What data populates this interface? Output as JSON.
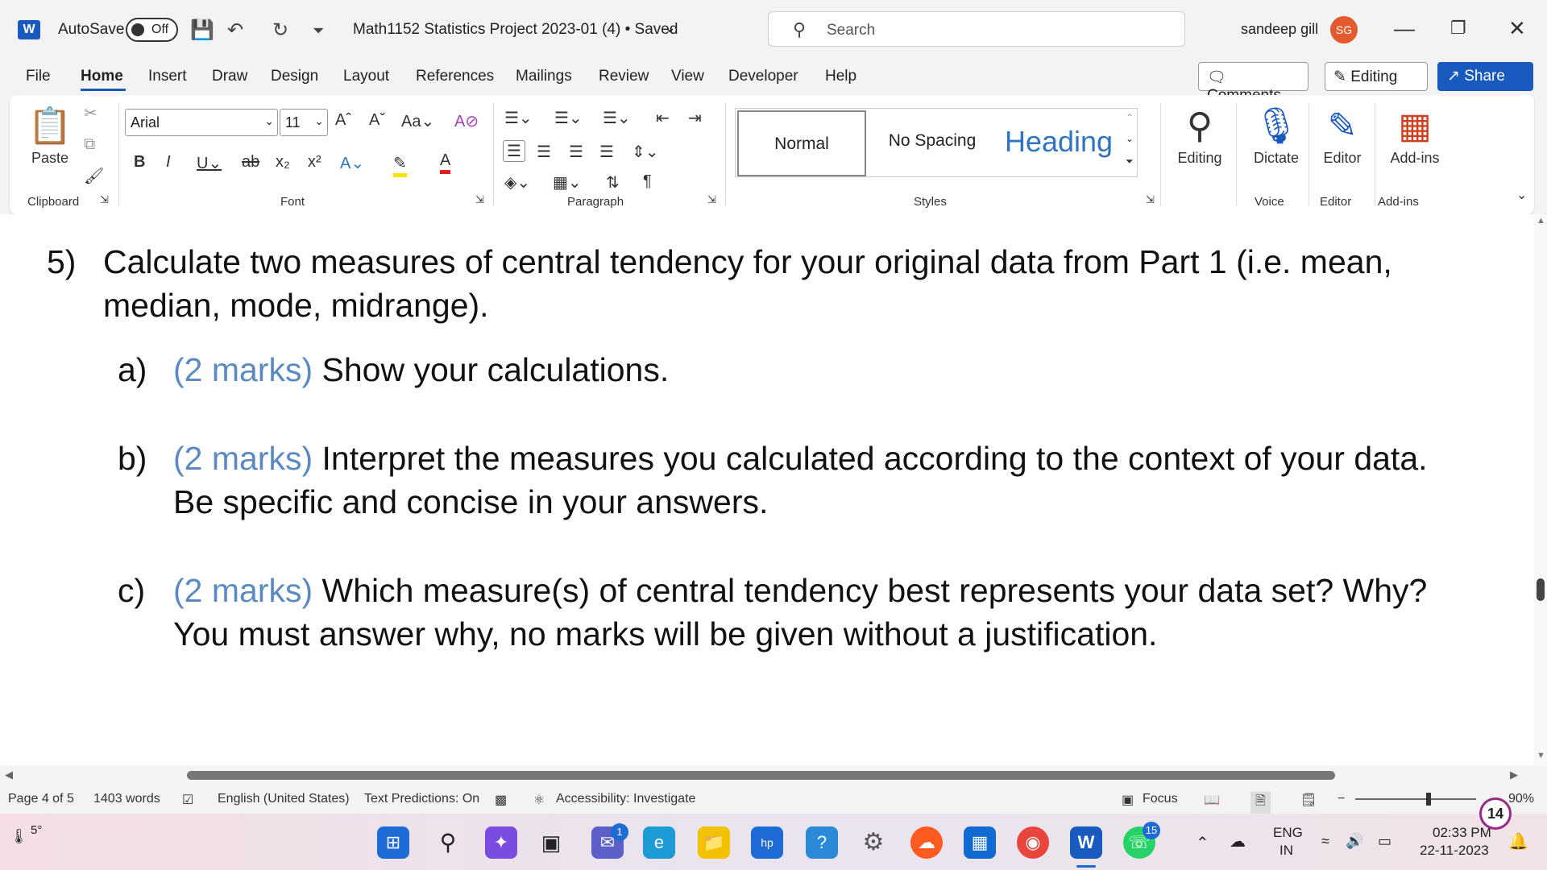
{
  "titlebar": {
    "autosave_label": "AutoSave",
    "autosave_state": "Off",
    "doc_title": "Math1152 Statistics Project 2023-01 (4) • Saved",
    "search_placeholder": "Search",
    "user_name": "sandeep gill",
    "user_initials": "SG"
  },
  "tabs": [
    "File",
    "Home",
    "Insert",
    "Draw",
    "Design",
    "Layout",
    "References",
    "Mailings",
    "Review",
    "View",
    "Developer",
    "Help"
  ],
  "tab_actions": {
    "comments": "Comments",
    "editing": "Editing",
    "share": "Share"
  },
  "ribbon": {
    "clipboard": {
      "paste": "Paste",
      "label": "Clipboard"
    },
    "font": {
      "name": "Arial",
      "size": "11",
      "label": "Font"
    },
    "paragraph": {
      "label": "Paragraph"
    },
    "styles": {
      "normal": "Normal",
      "no_spacing": "No Spacing",
      "heading": "Heading",
      "label": "Styles"
    },
    "editing": {
      "btn": "Editing"
    },
    "voice": {
      "btn": "Dictate",
      "label": "Voice"
    },
    "editor": {
      "btn": "Editor",
      "label": "Editor"
    },
    "addins": {
      "btn": "Add-ins",
      "label": "Add-ins"
    }
  },
  "document": {
    "q5_num": "5)",
    "q5_line1": "Calculate two measures of central tendency for your original data from Part 1 (i.e. mean,",
    "q5_line2": "median, mode, midrange).",
    "a_label": "a)",
    "a_marks": "(2 marks)",
    "a_text": " Show your calculations.",
    "b_label": "b)",
    "b_marks": "(2 marks)",
    "b_text": " Interpret the measures you calculated according to the context of your data.",
    "b_line2": "Be specific and concise in your answers.",
    "c_label": "c)",
    "c_marks": "(2 marks)",
    "c_text": " Which measure(s) of central tendency best represents your data set? Why?",
    "c_line2": "You must answer why, no marks will be given without a justification."
  },
  "statusbar": {
    "page": "Page 4 of 5",
    "words": "1403 words",
    "language": "English (United States)",
    "predictions": "Text Predictions: On",
    "accessibility": "Accessibility: Investigate",
    "focus": "Focus",
    "zoom": "90%"
  },
  "taskbar": {
    "weather": "5°",
    "chat_badge": "1",
    "whatsapp_badge": "15",
    "lang_line1": "ENG",
    "lang_line2": "IN",
    "time": "02:33 PM",
    "date": "22-11-2023",
    "notif_count": "14"
  }
}
